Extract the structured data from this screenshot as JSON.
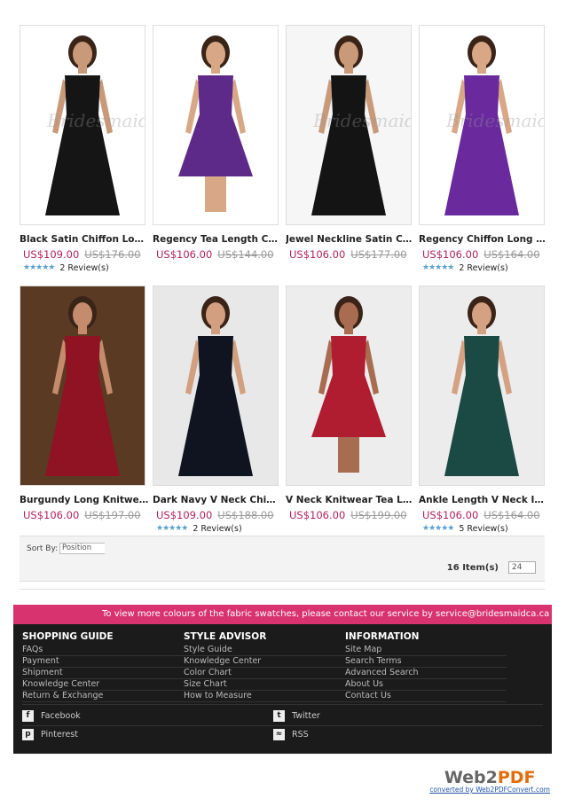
{
  "products": [
    {
      "name": "Black Satin Chiffon Long S...",
      "price": "US$109.00",
      "old_price": "US$176.00",
      "reviews": "2 Review(s)",
      "stars": "★★★★★",
      "dress_color": "#151515",
      "skin": "#c99a7a",
      "bg": "#ffffff"
    },
    {
      "name": "Regency Tea Length Chiffo",
      "price": "US$106.00",
      "old_price": "US$144.00",
      "reviews": "",
      "stars": "",
      "dress_color": "#5e2a8a",
      "skin": "#d8a886",
      "bg": "#ffffff"
    },
    {
      "name": "Jewel Neckline Satin Chiffo...",
      "price": "US$106.00",
      "old_price": "US$177.00",
      "reviews": "",
      "stars": "",
      "dress_color": "#141414",
      "skin": "#c99a7a",
      "bg": "#f6f6f6"
    },
    {
      "name": "Regency Chiffon Long One...",
      "price": "US$106.00",
      "old_price": "US$164.00",
      "reviews": "2 Review(s)",
      "stars": "★★★★★",
      "dress_color": "#6a2a9e",
      "skin": "#d8a886",
      "bg": "#ffffff"
    },
    {
      "name": "Burgundy Long Knitwear V",
      "price": "US$106.00",
      "old_price": "US$197.00",
      "reviews": "",
      "stars": "",
      "dress_color": "#8f1322",
      "skin": "#c48c6c",
      "bg": "#5b3a24"
    },
    {
      "name": "Dark Navy V Neck Chiffon ...",
      "price": "US$109.00",
      "old_price": "US$188.00",
      "reviews": "2 Review(s)",
      "stars": "★★★★★",
      "dress_color": "#0f1420",
      "skin": "#d2a080",
      "bg": "#e8e8e8"
    },
    {
      "name": "V Neck Knitwear Tea Leng...",
      "price": "US$106.00",
      "old_price": "US$199.00",
      "reviews": "",
      "stars": "",
      "dress_color": "#b01c30",
      "skin": "#a86c50",
      "bg": "#ededed"
    },
    {
      "name": "Ankle Length V Neck Ink B...",
      "price": "US$106.00",
      "old_price": "US$164.00",
      "reviews": "5 Review(s)",
      "stars": "★★★★★",
      "dress_color": "#1b4a44",
      "skin": "#d4a282",
      "bg": "#ececec"
    }
  ],
  "sort": {
    "label": "Sort By:",
    "value": "Position"
  },
  "items": {
    "count": "16 Item(s)",
    "per_page": "24"
  },
  "promo": "To view more colours of the fabric swatches, please contact our service by service@bridesmaidca.ca",
  "footer": {
    "shopping": {
      "title": "SHOPPING GUIDE",
      "links": [
        "FAQs",
        "Payment",
        "Shipment",
        "Knowledge Center",
        "Return & Exchange"
      ]
    },
    "style": {
      "title": "STYLE ADVISOR",
      "links": [
        "Style Guide",
        "Knowledge Center",
        "Color Chart",
        "Size Chart",
        "How to Measure"
      ]
    },
    "info": {
      "title": "INFORMATION",
      "links": [
        "Site Map",
        "Search Terms",
        "Advanced Search",
        "About Us",
        "Contact Us"
      ]
    },
    "social": {
      "facebook": "Facebook",
      "twitter": "Twitter",
      "pinterest": "Pinterest",
      "rss": "RSS"
    }
  },
  "badge": {
    "logo_a": "Web2",
    "logo_b": "PDF",
    "converted": "converted by Web2PDFConvert.com"
  },
  "watermark": "Bridesmaid"
}
